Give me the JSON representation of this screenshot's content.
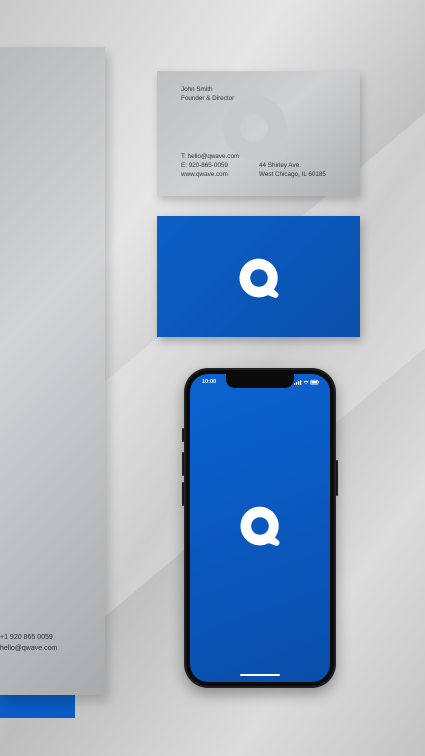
{
  "letterhead": {
    "phone_line": "+1 920 865 0059",
    "email_line": "hello@qwave.com"
  },
  "business_card": {
    "name": "John Smith",
    "title": "Founder & Director",
    "phone_line": "T: hello@qwave.com",
    "email_line": "E: 920-865-0059",
    "website": "www.qwave.com",
    "address_line1": "44 Shirley Ave.",
    "address_line2": "West Chicago, IL 60185"
  },
  "phone": {
    "status_time": "10:00"
  },
  "colors": {
    "brand_blue": "#0a5cc2",
    "paper_gray": "#c4c5c7"
  },
  "icons": [
    "q-logo-icon",
    "signal-icon",
    "wifi-icon",
    "battery-icon"
  ]
}
